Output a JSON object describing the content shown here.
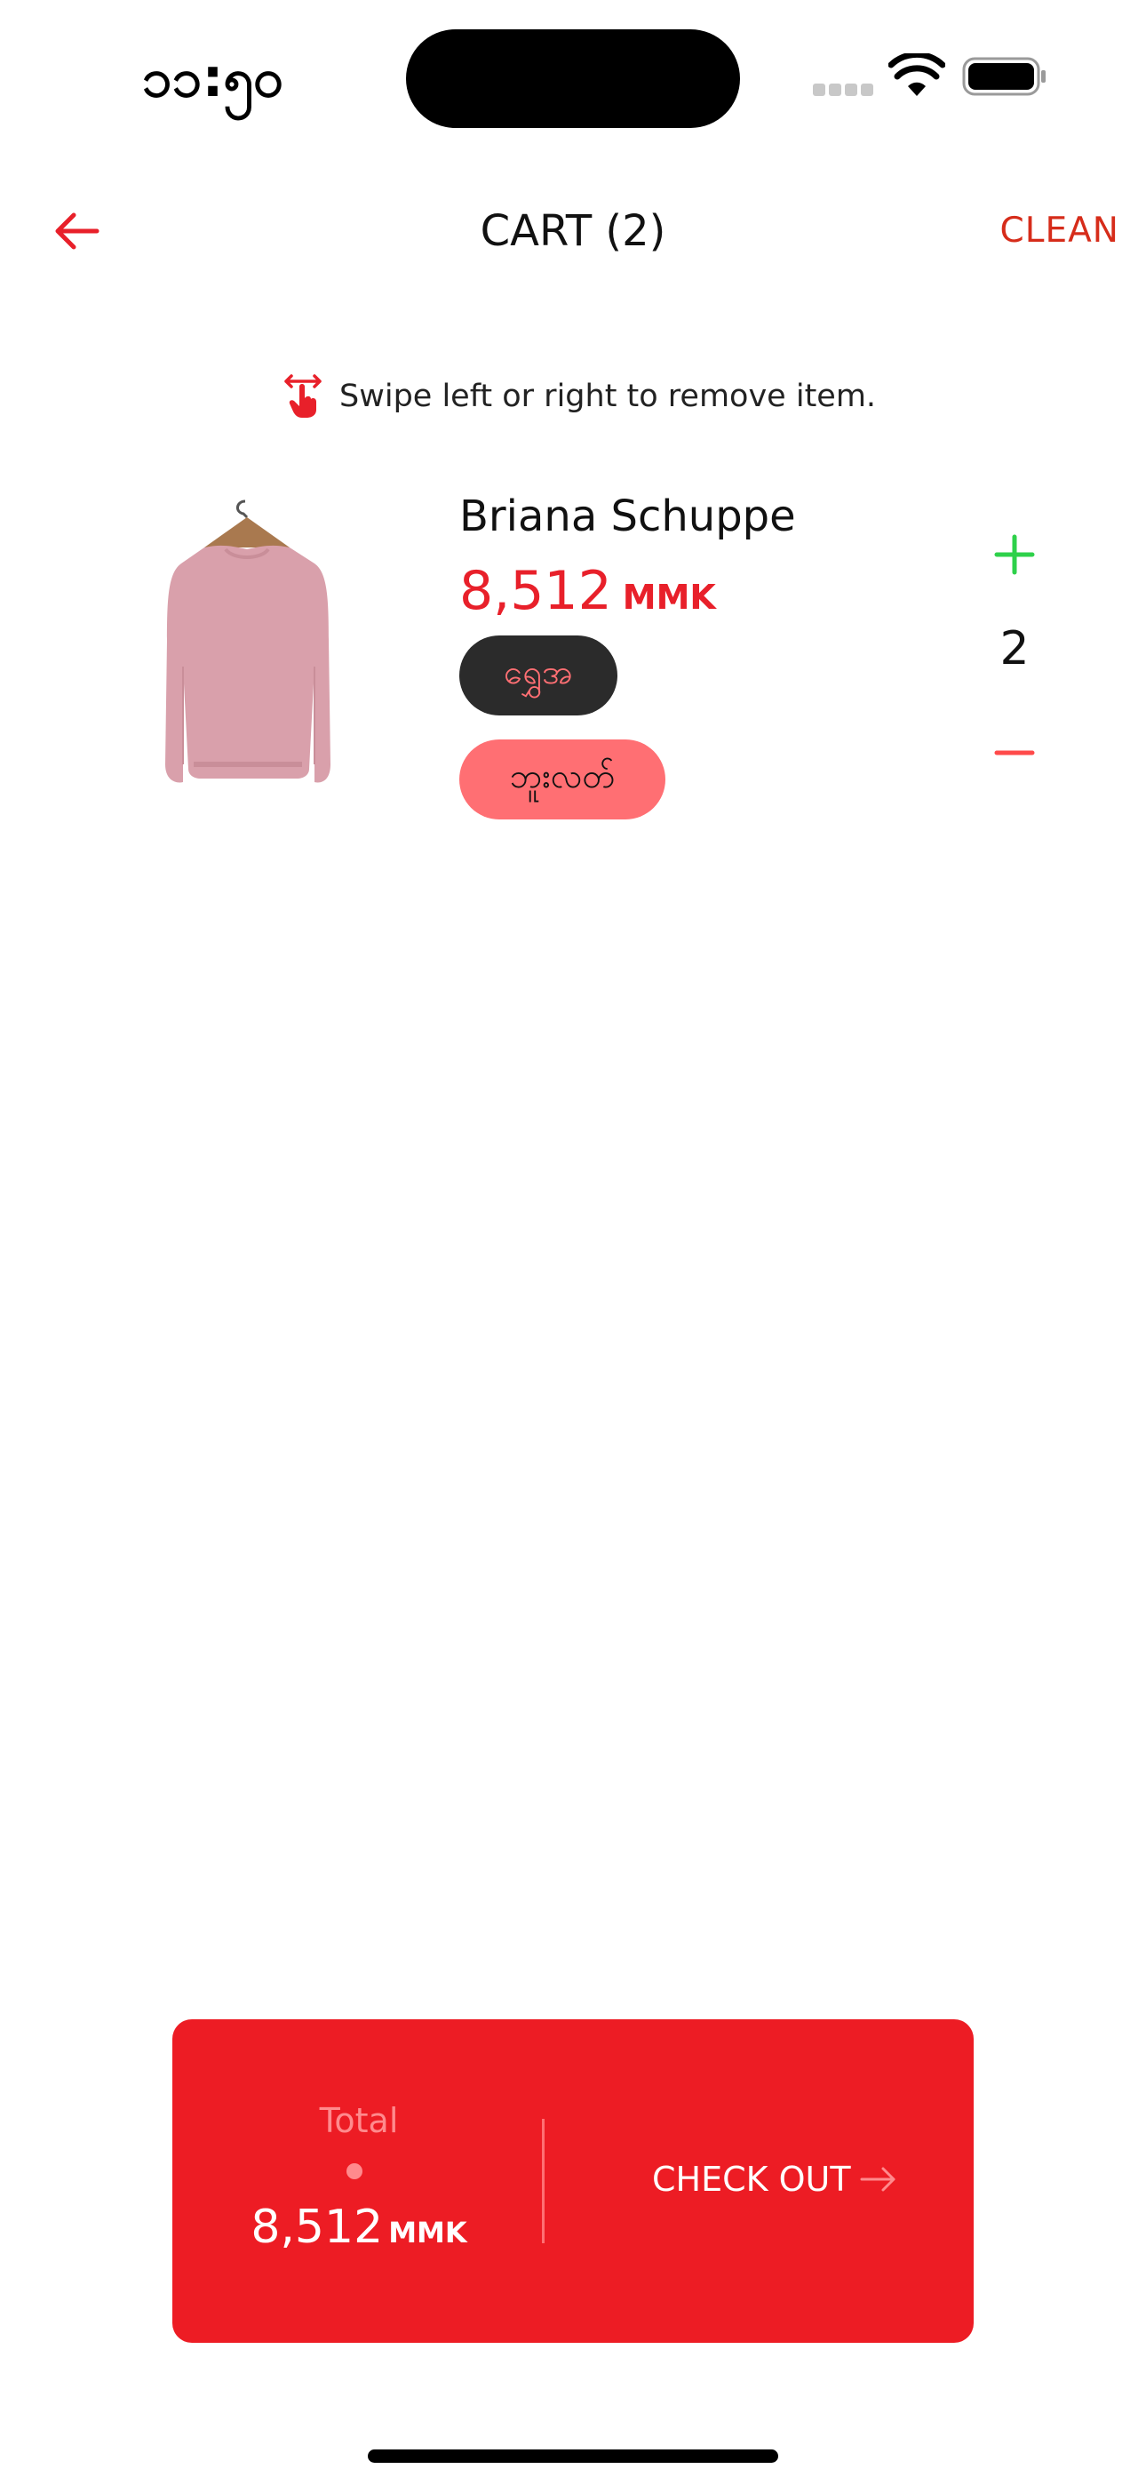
{
  "status_bar": {
    "time": "၁၁:၅၀"
  },
  "header": {
    "title": "CART (2)",
    "clean_label": "CLEAN"
  },
  "hint": {
    "text": "Swipe left or right to remove item.",
    "icon": "swipe-hand-icon"
  },
  "cart_items": [
    {
      "name": "Briana Schuppe",
      "price": "8,512",
      "currency": "MMK",
      "color_chip": "ရွှေအ",
      "size_chip": "ဘူးလတ်",
      "quantity": "2",
      "image": "pink-sweater-on-hanger"
    }
  ],
  "checkout": {
    "total_label": "Total",
    "total_amount": "8,512",
    "currency": "MMK",
    "button_label": "CHECK OUT"
  },
  "colors": {
    "accent": "#ed1c24",
    "price": "#e8202a",
    "plus": "#2ed14a",
    "minus": "#ff4a4a",
    "chip_dark": "#2b2b2b",
    "chip_pink": "#ff6f73"
  }
}
